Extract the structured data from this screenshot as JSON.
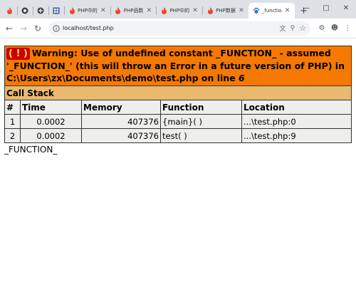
{
  "browser": {
    "tabs": [
      {
        "label": "",
        "icon": "fire-icon",
        "active": false
      },
      {
        "label": "",
        "icon": "globe-icon",
        "active": false
      },
      {
        "label": "",
        "icon": "globe-icon",
        "active": false
      },
      {
        "label": "",
        "icon": "grid-icon",
        "active": false
      },
      {
        "label": "PHP中的",
        "icon": "fire-icon",
        "active": false
      },
      {
        "label": "PHP函数",
        "icon": "fire-icon",
        "active": false
      },
      {
        "label": "PHP中的",
        "icon": "fire-icon",
        "active": false
      },
      {
        "label": "PHP数据",
        "icon": "fire-icon",
        "active": false
      },
      {
        "label": "_functio",
        "icon": "paw-icon",
        "active": true
      }
    ],
    "new_tab_label": "+",
    "url": "localhost/test.php"
  },
  "error": {
    "icon_text": "( ! )",
    "line1": "Warning: Use of undefined constant _FUNCTION_ - assumed",
    "line2": "'_FUNCTION_' (this will throw an Error in a future version of PHP) in",
    "line3_path": "C:\\Users\\zx\\Documents\\demo\\test.php on line ",
    "line_number": "6",
    "stack_title": "Call Stack",
    "headers": [
      "#",
      "Time",
      "Memory",
      "Function",
      "Location"
    ],
    "rows": [
      {
        "num": "1",
        "time": "0.0002",
        "memory": "407376",
        "function": "{main}( )",
        "location": "...\\test.php:0"
      },
      {
        "num": "2",
        "time": "0.0002",
        "memory": "407376",
        "function": "test( )",
        "location": "...\\test.php:9"
      }
    ]
  },
  "output_text": "_FUNCTION_",
  "colors": {
    "warning_bg": "#f57900",
    "bang_bg": "#cc0000",
    "bang_fg": "#fce94f",
    "stack_bg": "#e9b96e",
    "cell_bg": "#eeeeec",
    "tab_strip_bg": "#dee1e6"
  }
}
